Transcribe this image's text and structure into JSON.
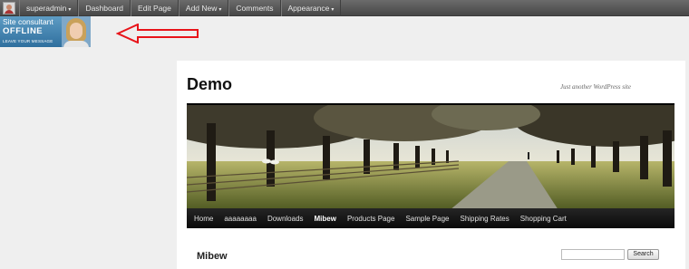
{
  "admin_bar": {
    "items": [
      {
        "label": "superadmin",
        "dropdown": true
      },
      {
        "label": "Dashboard",
        "dropdown": false
      },
      {
        "label": "Edit Page",
        "dropdown": false
      },
      {
        "label": "Add New",
        "dropdown": true
      },
      {
        "label": "Comments",
        "dropdown": false
      },
      {
        "label": "Appearance",
        "dropdown": true
      }
    ],
    "dropdown_glyph": "▾"
  },
  "consultant": {
    "line1": "Site consultant",
    "line2": "OFFLINE",
    "line3": "LEAVE YOUR MESSAGE"
  },
  "site": {
    "title": "Demo",
    "description": "Just another WordPress site"
  },
  "nav": {
    "items": [
      "Home",
      "aaaaaaaa",
      "Downloads",
      "Mibew",
      "Products Page",
      "Sample Page",
      "Shipping Rates",
      "Shopping Cart"
    ],
    "current": "Mibew"
  },
  "post": {
    "title": "Mibew"
  },
  "search": {
    "placeholder": "",
    "button_label": "Search"
  },
  "colors": {
    "annotation_arrow": "#e8141a",
    "admin_bar": "#555555",
    "nav_bar": "#111111"
  }
}
